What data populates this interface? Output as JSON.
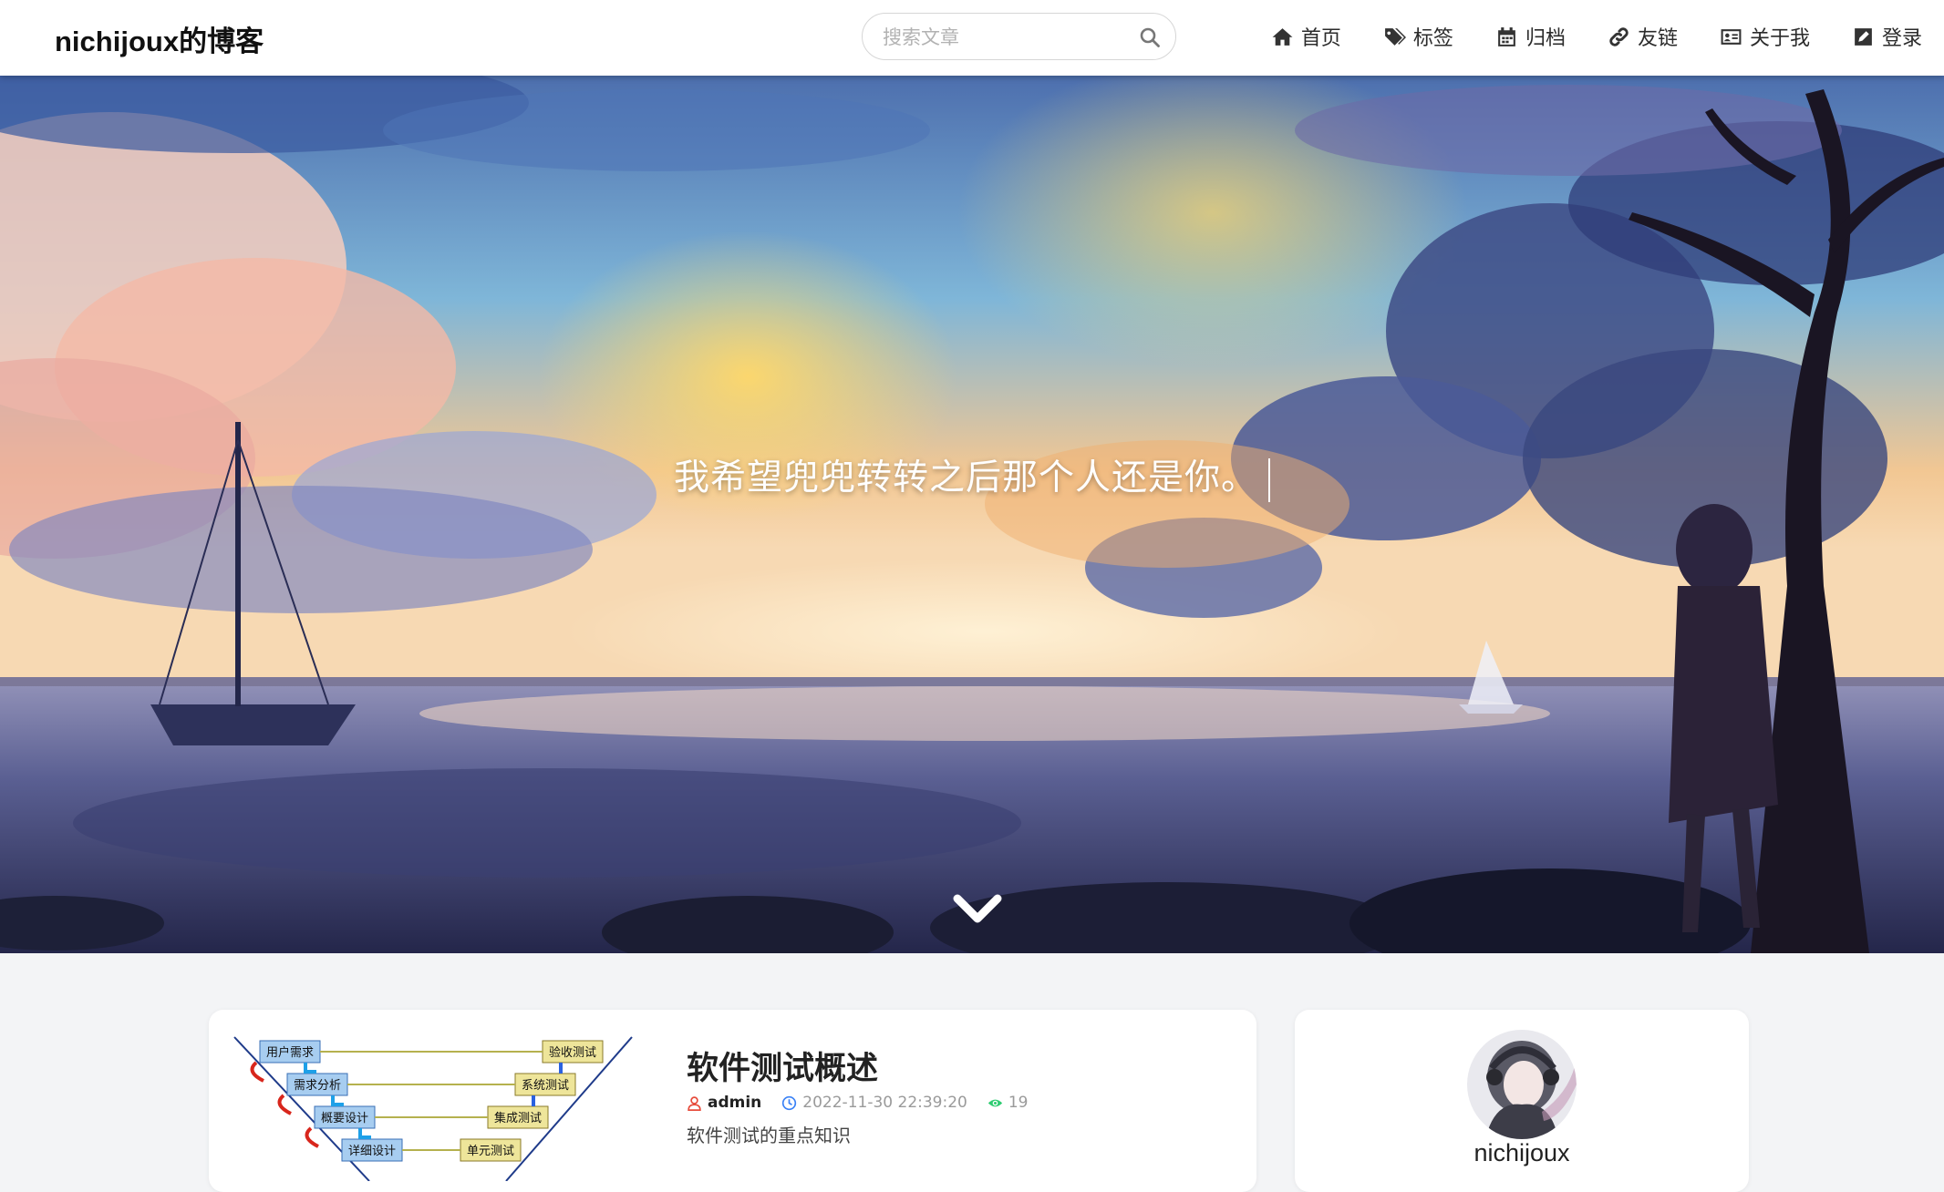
{
  "brand": {
    "title": "nichijoux的博客"
  },
  "search": {
    "placeholder": "搜索文章",
    "icon": "search-icon"
  },
  "nav": {
    "items": [
      {
        "label": "首页",
        "icon": "home-icon"
      },
      {
        "label": "标签",
        "icon": "tags-icon"
      },
      {
        "label": "归档",
        "icon": "calendar-icon"
      },
      {
        "label": "友链",
        "icon": "link-icon"
      },
      {
        "label": "关于我",
        "icon": "id-card-icon"
      },
      {
        "label": "登录",
        "icon": "login-icon"
      }
    ]
  },
  "hero": {
    "quote": "我希望兜兜转转之后那个人还是你。",
    "scroll_icon": "chevron-down-icon"
  },
  "post": {
    "title": "软件测试概述",
    "author": "admin",
    "date": "2022-11-30 22:39:20",
    "views": "19",
    "summary": "软件测试的重点知识",
    "thumbnail": {
      "left_steps": [
        "用户需求",
        "需求分析",
        "概要设计",
        "详细设计"
      ],
      "right_steps": [
        "验收测试",
        "系统测试",
        "集成测试",
        "单元测试"
      ]
    }
  },
  "profile": {
    "name": "nichijoux"
  },
  "colors": {
    "accent_blue": "#4a90e2",
    "views_green": "#2ecc71",
    "author_icon_red": "#e74c3c",
    "date_icon_blue": "#3b82f6"
  }
}
